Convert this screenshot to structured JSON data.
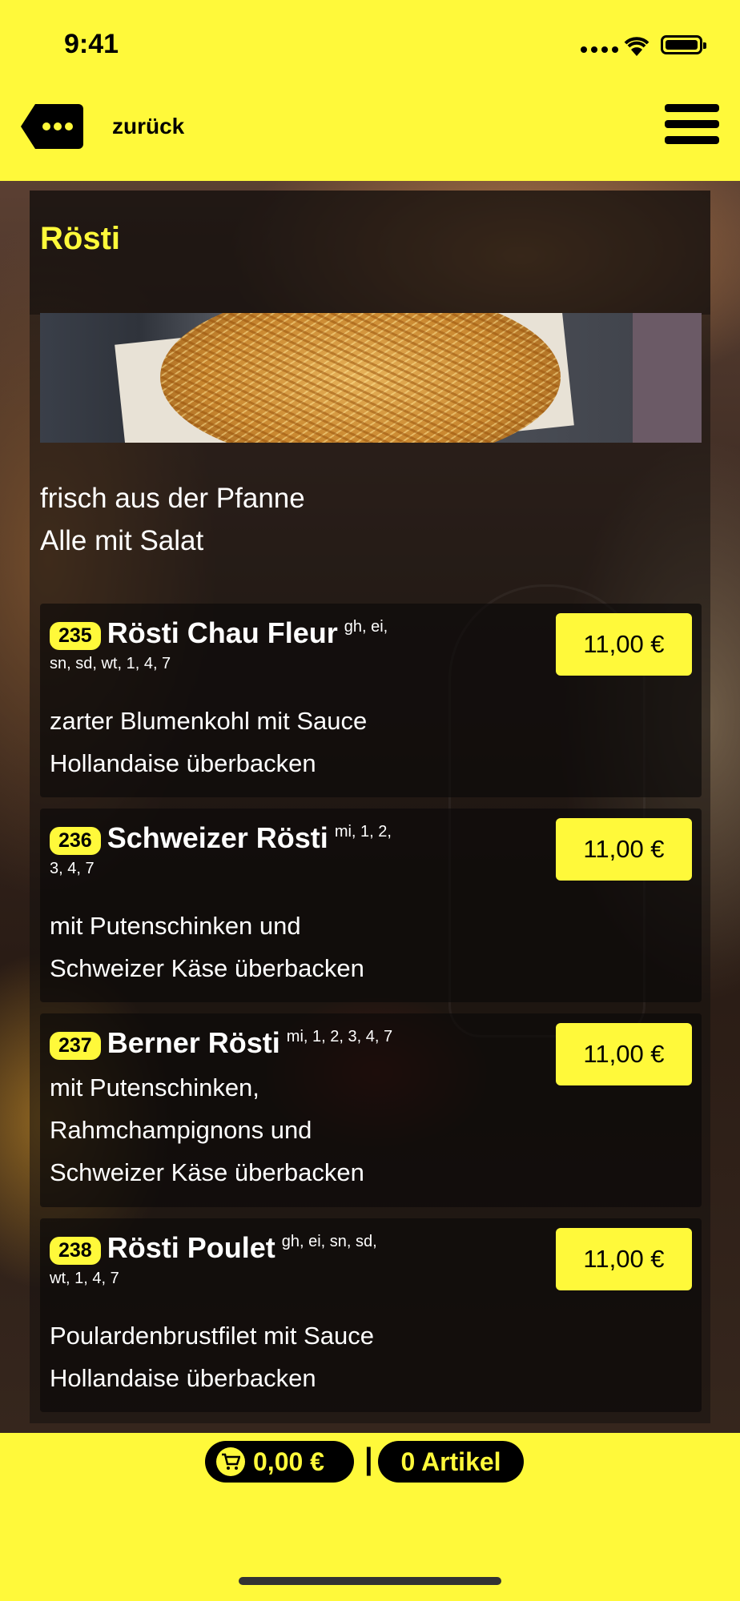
{
  "status_bar": {
    "time": "9:41"
  },
  "header": {
    "back_label": "zurück"
  },
  "category": {
    "title": "Rösti",
    "intro_line1": "frisch aus der Pfanne",
    "intro_line2": "Alle mit Salat"
  },
  "items": [
    {
      "number": "235",
      "name": "Rösti Chau Fleur",
      "allergens_1": "gh, ei,",
      "allergens_2": "sn, sd, wt, 1, 4, 7",
      "desc_1": "zarter Blumenkohl mit Sauce",
      "desc_2": "Hollandaise überbacken",
      "price": "11,00 €"
    },
    {
      "number": "236",
      "name": "Schweizer Rösti",
      "allergens_1": "mi, 1, 2,",
      "allergens_2": "3, 4, 7",
      "desc_1": "mit Putenschinken und",
      "desc_2": "Schweizer Käse überbacken",
      "price": "11,00 €"
    },
    {
      "number": "237",
      "name": "Berner Rösti",
      "allergens_1": "mi, 1, 2, 3, 4, 7",
      "desc_1": "mit Putenschinken,",
      "desc_2": "Rahmchampignons und",
      "desc_3": "Schweizer Käse überbacken",
      "price": "11,00 €"
    },
    {
      "number": "238",
      "name": "Rösti Poulet",
      "allergens_1": "gh, ei, sn, sd,",
      "allergens_2": "wt, 1, 4, 7",
      "desc_1": "Poulardenbrustfilet mit Sauce",
      "desc_2": "Hollandaise überbacken",
      "price": "11,00 €"
    }
  ],
  "cart": {
    "total": "0,00 €",
    "separator": "|",
    "count": "0 Artikel"
  },
  "colors": {
    "accent": "#fff93a",
    "dark": "#000000"
  }
}
